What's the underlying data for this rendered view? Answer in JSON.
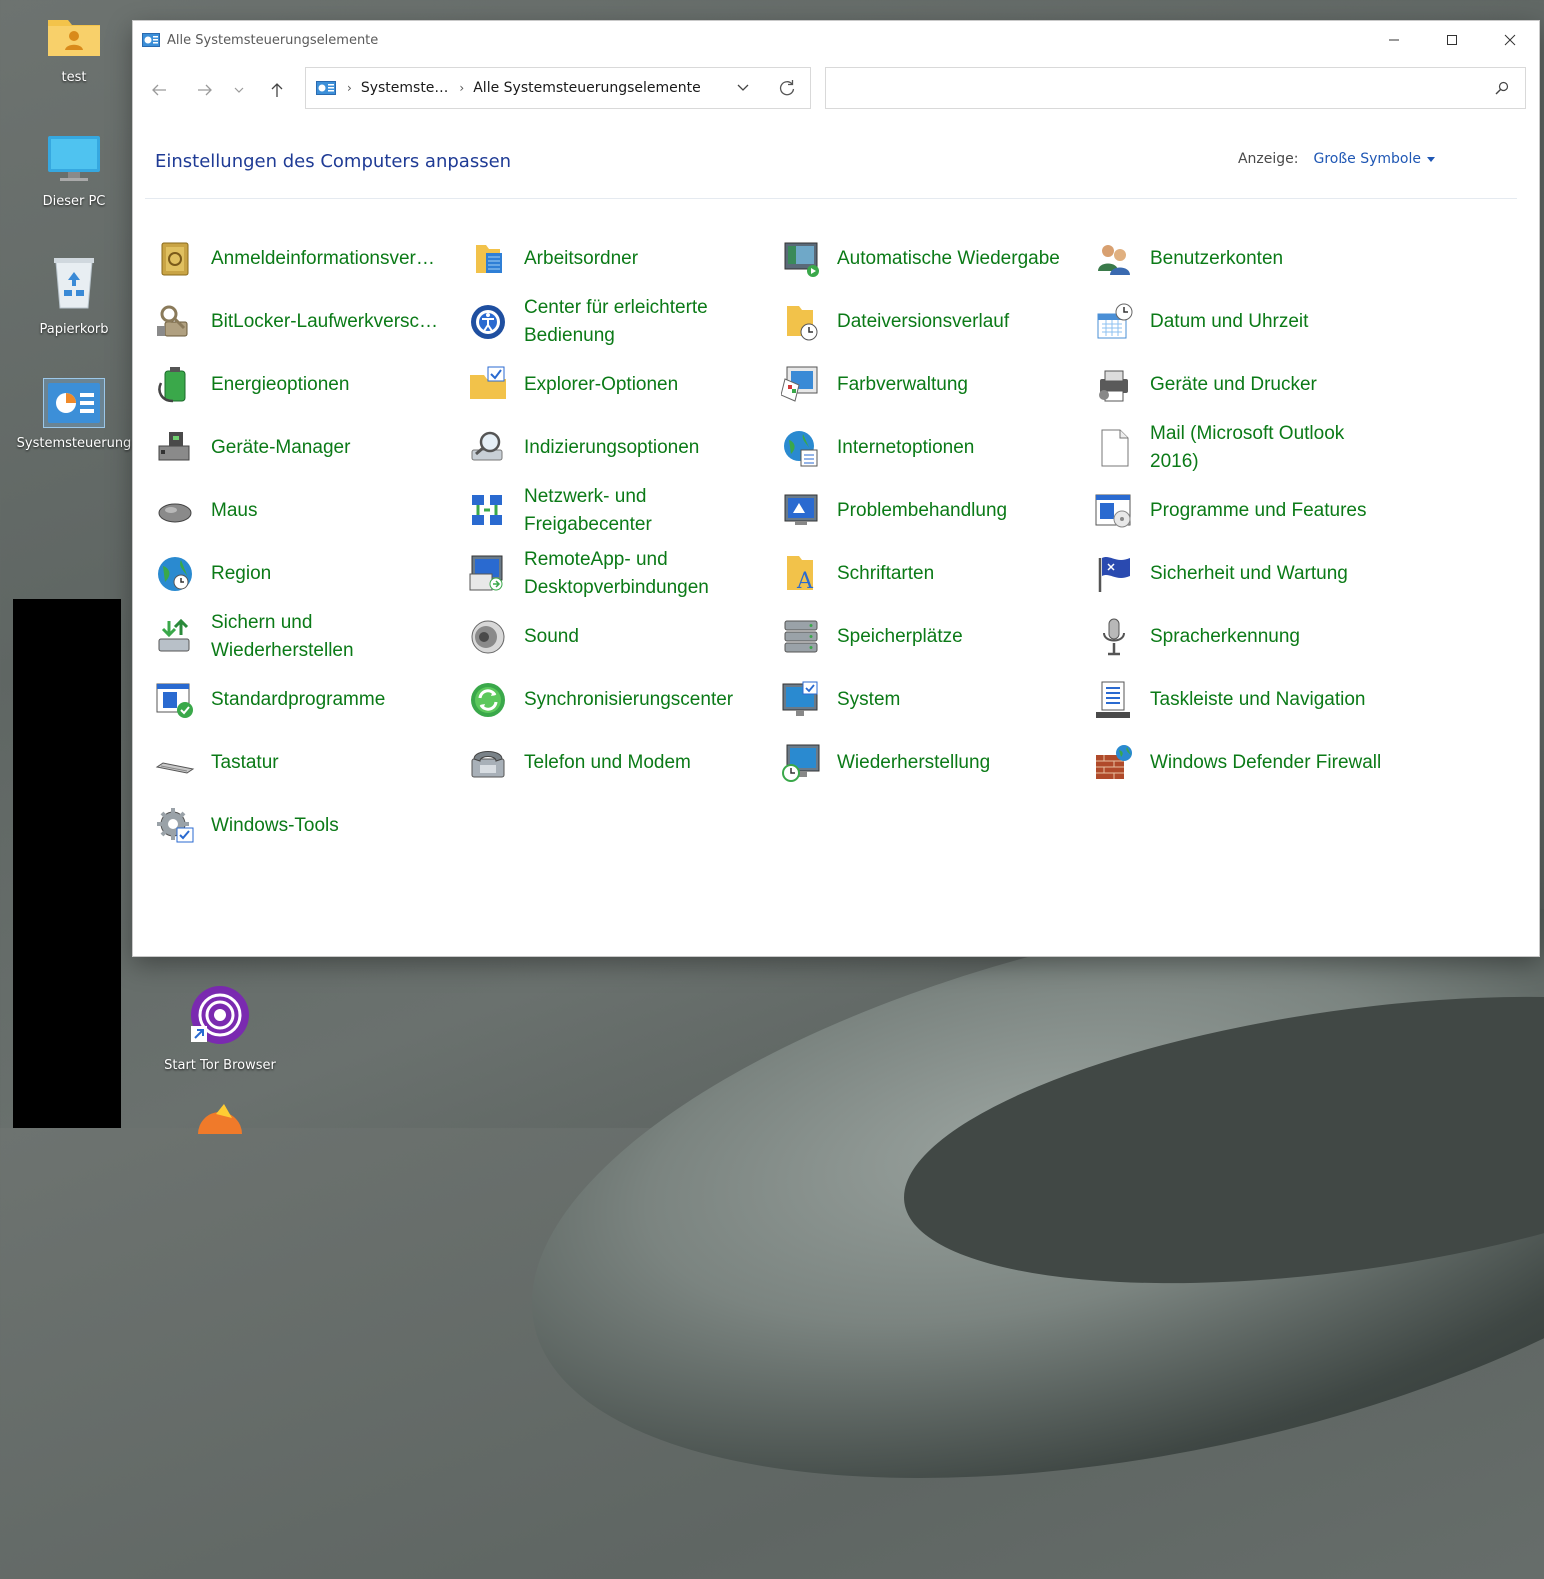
{
  "desktop": {
    "icons": [
      {
        "label": "test",
        "icon": "user-folder-icon"
      },
      {
        "label": "Dieser PC",
        "icon": "monitor-icon"
      },
      {
        "label": "Papierkorb",
        "icon": "recycle-bin-icon"
      },
      {
        "label": "Systemsteuerung",
        "icon": "control-panel-icon"
      },
      {
        "label": "Start Tor Browser",
        "icon": "tor-browser-icon"
      }
    ]
  },
  "window": {
    "title": "Alle Systemsteuerungselemente",
    "breadcrumb": [
      "Systemste…",
      "Alle Systemsteuerungselemente"
    ],
    "search_placeholder": "",
    "heading": "Einstellungen des Computers anpassen",
    "view_label": "Anzeige:",
    "view_value": "Große Symbole"
  },
  "items": [
    {
      "label": "Anmeldeinformationsver…",
      "icon": "credential-safe-icon",
      "color": "#b8962e"
    },
    {
      "label": "Arbeitsordner",
      "icon": "work-folders-icon",
      "color": "#2f7fd6"
    },
    {
      "label": "Automatische Wiedergabe",
      "icon": "autoplay-icon",
      "color": "#3a9a45"
    },
    {
      "label": "Benutzerkonten",
      "icon": "user-accounts-icon",
      "color": "#c07a3a"
    },
    {
      "label": "BitLocker-Laufwerkversch…",
      "icon": "bitlocker-key-icon",
      "color": "#8a7a5a"
    },
    {
      "label": "Center für erleichterte Bedienung",
      "icon": "ease-of-access-icon",
      "color": "#2a5fb3"
    },
    {
      "label": "Dateiversionsverlauf",
      "icon": "file-history-icon",
      "color": "#e0b64a"
    },
    {
      "label": "Datum und Uhrzeit",
      "icon": "date-time-icon",
      "color": "#4a8fd6"
    },
    {
      "label": "Energieoptionen",
      "icon": "power-battery-icon",
      "color": "#3aa84a"
    },
    {
      "label": "Explorer-Optionen",
      "icon": "explorer-options-icon",
      "color": "#e8c052"
    },
    {
      "label": "Farbverwaltung",
      "icon": "color-management-icon",
      "color": "#d04a8a"
    },
    {
      "label": "Geräte und Drucker",
      "icon": "printer-icon",
      "color": "#6a6a6a"
    },
    {
      "label": "Geräte-Manager",
      "icon": "device-manager-icon",
      "color": "#6a6a6a"
    },
    {
      "label": "Indizierungsoptionen",
      "icon": "indexing-magnifier-icon",
      "color": "#8a9aa8"
    },
    {
      "label": "Internetoptionen",
      "icon": "internet-globe-icon",
      "color": "#2a8ad0"
    },
    {
      "label": "Mail (Microsoft Outlook 2016)",
      "icon": "blank-file-icon",
      "color": "#ffffff"
    },
    {
      "label": "Maus",
      "icon": "mouse-icon",
      "color": "#777777"
    },
    {
      "label": "Netzwerk- und Freigabecenter",
      "icon": "network-icon",
      "color": "#2a6ad0"
    },
    {
      "label": "Problembehandlung",
      "icon": "troubleshooting-icon",
      "color": "#2a6ad0"
    },
    {
      "label": "Programme und Features",
      "icon": "programs-features-icon",
      "color": "#2a6ad0"
    },
    {
      "label": "Region",
      "icon": "region-globe-icon",
      "color": "#2a8ad0"
    },
    {
      "label": "RemoteApp- und Desktopverbindungen",
      "icon": "remote-desktop-icon",
      "color": "#2a6ad0"
    },
    {
      "label": "Schriftarten",
      "icon": "fonts-folder-icon",
      "color": "#e0b64a"
    },
    {
      "label": "Sicherheit und Wartung",
      "icon": "security-flag-icon",
      "color": "#2a4ab0"
    },
    {
      "label": "Sichern und Wiederherstellen",
      "icon": "backup-restore-icon",
      "color": "#3aa84a"
    },
    {
      "label": "Sound",
      "icon": "speaker-icon",
      "color": "#8a8a8a"
    },
    {
      "label": "Speicherplätze",
      "icon": "storage-spaces-icon",
      "color": "#8a8a8a"
    },
    {
      "label": "Spracherkennung",
      "icon": "microphone-icon",
      "color": "#8a8a8a"
    },
    {
      "label": "Standardprogramme",
      "icon": "default-programs-icon",
      "color": "#2a6ad0"
    },
    {
      "label": "Synchronisierungscenter",
      "icon": "sync-center-icon",
      "color": "#3aa84a"
    },
    {
      "label": "System",
      "icon": "system-monitor-icon",
      "color": "#2a8ad0"
    },
    {
      "label": "Taskleiste und Navigation",
      "icon": "taskbar-icon",
      "color": "#4a4a4a"
    },
    {
      "label": "Tastatur",
      "icon": "keyboard-icon",
      "color": "#8a8a8a"
    },
    {
      "label": "Telefon und Modem",
      "icon": "phone-modem-icon",
      "color": "#8a8a8a"
    },
    {
      "label": "Wiederherstellung",
      "icon": "recovery-icon",
      "color": "#2a8ad0"
    },
    {
      "label": "Windows Defender Firewall",
      "icon": "firewall-icon",
      "color": "#b04a2a"
    },
    {
      "label": "Windows-Tools",
      "icon": "windows-tools-gear-icon",
      "color": "#8a8a8a"
    }
  ]
}
